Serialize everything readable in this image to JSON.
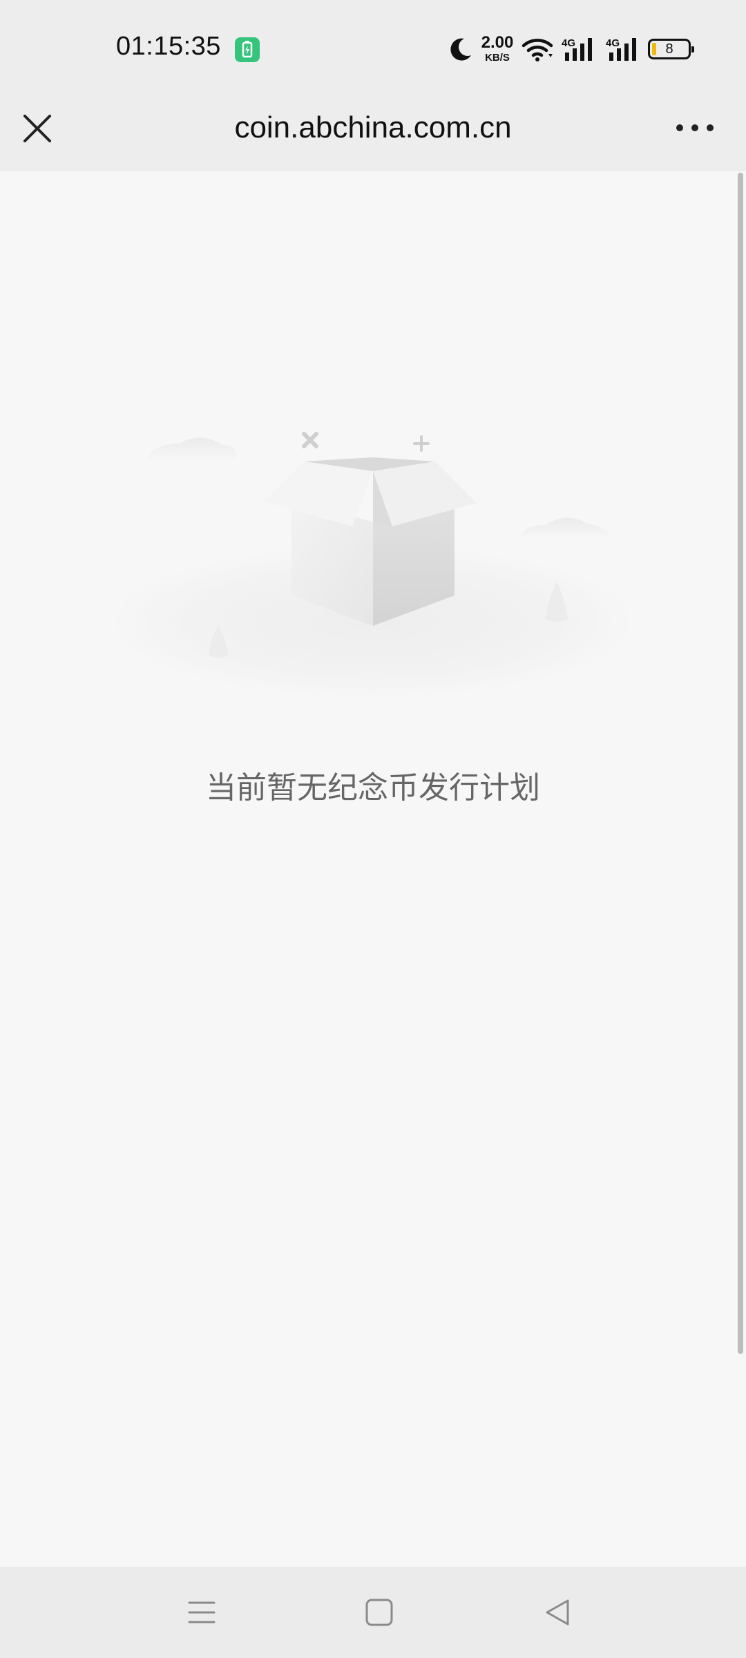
{
  "status_bar": {
    "time": "01:15:35",
    "net_speed_value": "2.00",
    "net_speed_unit": "KB/S",
    "battery_level": "8",
    "network_1": "4G",
    "network_2": "4G"
  },
  "webview": {
    "title": "coin.abchina.com.cn",
    "icons": {
      "close": "close-icon",
      "more": "more-icon"
    }
  },
  "empty_state": {
    "message": "当前暂无纪念币发行计划",
    "illustration": "empty-box-icon"
  },
  "nav_bar": {
    "icons": [
      "menu-icon",
      "home-icon",
      "back-icon"
    ]
  },
  "colors": {
    "background": "#f7f7f7",
    "bar_background": "#ededed",
    "charge_badge": "#34c47a",
    "battery_fill": "#f1b90b",
    "message_text": "#666666"
  }
}
